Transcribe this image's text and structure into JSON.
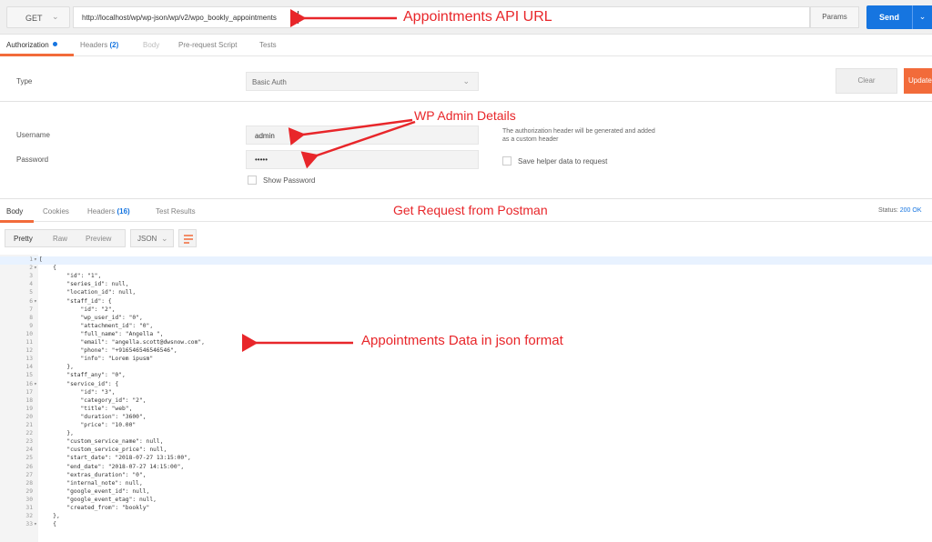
{
  "request": {
    "method": "GET",
    "url": "http://localhost/wp/wp-json/wp/v2/wpo_bookly_appointments",
    "params_label": "Params",
    "send_label": "Send"
  },
  "request_tabs": {
    "authorization": "Authorization",
    "headers": "Headers",
    "headers_count": "(2)",
    "body": "Body",
    "prerequest": "Pre-request Script",
    "tests": "Tests"
  },
  "auth": {
    "type_label": "Type",
    "type_value": "Basic Auth",
    "clear_label": "Clear",
    "update_label": "Update",
    "username_label": "Username",
    "username_value": "admin",
    "password_label": "Password",
    "password_value": "•••••",
    "show_password_label": "Show Password",
    "note": "The authorization header will be generated and added as a custom header",
    "save_helper_label": "Save helper data to request"
  },
  "response_tabs": {
    "body": "Body",
    "cookies": "Cookies",
    "headers": "Headers",
    "headers_count": "(16)",
    "test_results": "Test Results",
    "status_label": "Status:",
    "status_value": "200 OK"
  },
  "view": {
    "pretty": "Pretty",
    "raw": "Raw",
    "preview": "Preview",
    "format": "JSON"
  },
  "code_lines": [
    "[",
    "    {",
    "        \"id\": \"1\",",
    "        \"series_id\": null,",
    "        \"location_id\": null,",
    "        \"staff_id\": {",
    "            \"id\": \"2\",",
    "            \"wp_user_id\": \"0\",",
    "            \"attachment_id\": \"0\",",
    "            \"full_name\": \"Angella \",",
    "            \"email\": \"angella.scott@dwsnow.com\",",
    "            \"phone\": \"+916546546546546\",",
    "            \"info\": \"Lorem ipusm\"",
    "        },",
    "        \"staff_any\": \"0\",",
    "        \"service_id\": {",
    "            \"id\": \"3\",",
    "            \"category_id\": \"2\",",
    "            \"title\": \"web\",",
    "            \"duration\": \"3600\",",
    "            \"price\": \"10.00\"",
    "        },",
    "        \"custom_service_name\": null,",
    "        \"custom_service_price\": null,",
    "        \"start_date\": \"2018-07-27 13:15:00\",",
    "        \"end_date\": \"2018-07-27 14:15:00\",",
    "        \"extras_duration\": \"0\",",
    "        \"internal_note\": null,",
    "        \"google_event_id\": null,",
    "        \"google_event_etag\": null,",
    "        \"created_from\": \"bookly\"",
    "    },",
    "    {"
  ],
  "annotations": {
    "url": "Appointments API URL",
    "admin": "WP Admin Details",
    "get": "Get Request from Postman",
    "data": "Appointments Data in json format"
  },
  "colors": {
    "accent_orange": "#f26b3a",
    "send_blue": "#1675e0",
    "annotation_red": "#e8262a"
  }
}
